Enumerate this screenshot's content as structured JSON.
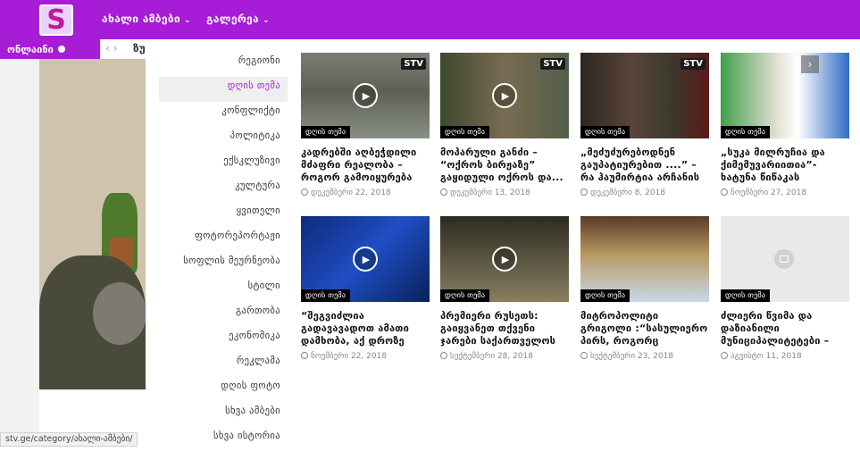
{
  "header": {
    "nav": [
      {
        "label": "ახალი ამბები"
      },
      {
        "label": "გალერეა"
      }
    ]
  },
  "ticker": {
    "online_label": "ონლაინი",
    "text": "ზუ"
  },
  "categories": [
    {
      "label": "რეგიონი"
    },
    {
      "label": "დღის თემა"
    },
    {
      "label": "კონფლიქტი"
    },
    {
      "label": "პოლიტიკა"
    },
    {
      "label": "ექსკლუზივი"
    },
    {
      "label": "კულტურა"
    },
    {
      "label": "ყვითელი"
    },
    {
      "label": "ფოტორეპორტაჟი"
    },
    {
      "label": "სოფლის მეურნეობა"
    },
    {
      "label": "სტილი"
    },
    {
      "label": "გართობა"
    },
    {
      "label": "ეკონომიკა"
    },
    {
      "label": "რეკლამა"
    },
    {
      "label": "დღის ფოტო"
    },
    {
      "label": "სხვა ამბები"
    },
    {
      "label": "სხვა ისტორია"
    }
  ],
  "active_category": "დღის თემა",
  "posts": [
    {
      "badge": "დღის თემა",
      "title": "კადრებში აღბეჭდილი მძაფრი რეალობა – როგორ გამოიყურება სახლი,...",
      "date": "დეკემბერი 22, 2018",
      "video": true
    },
    {
      "badge": "დღის თემა",
      "title": "მოპარული განძი – “ოქროს ბირჟაზე” გაყიდული ოქროს და...",
      "date": "დეკემბერი 13, 2018",
      "video": true
    },
    {
      "badge": "დღის თემა",
      "title": "„მეძუძურებოდნენ გაუპატიურებით ....” – რა ჰაუმირტია არჩანის წამებასთან...",
      "date": "დეკემბერი 8, 2018",
      "video": true
    },
    {
      "badge": "დღის თემა",
      "title": "„სუკა მილრუჩია და ქიმემუვარიითია”-ხატუნა წიწაკას ლიტერატურული ესე...",
      "date": "ნოემბერი 27, 2018",
      "video": false
    },
    {
      "badge": "დღის თემა",
      "title": "“შეგვიძლია გადავავადოთ ამათი დამხობა, აქ დროზე დავამხოთ...”-ახალი ფარული...",
      "date": "ნოემბერი 22, 2018",
      "video": true
    },
    {
      "badge": "დღის თემა",
      "title": "პრემიერი რუსეთს: გაიყვანეთ თქვენი ჯარები საქართველოს ტერიტორიიდან",
      "date": "სექტემბერი 28, 2018",
      "video": true
    },
    {
      "badge": "დღის თემა",
      "title": "მიტროპოლიტი გრიგოლი :“სასულიერო პირს, როგორც მოქალაქეს აქვს უფლებამოსილება,...",
      "date": "სექტემბერი 23, 2018",
      "video": false
    },
    {
      "badge": "დღის თემა",
      "title": "ძლიერი წვიმა და დაზიანილი მუნიციპალიტეტები – საგზაუროვლი სიტუაცი...",
      "date": "აგვისტო 11, 2018",
      "video": false
    }
  ],
  "thumb_labels": [
    "STV",
    "STV",
    "STV"
  ],
  "status_url": "stv.ge/category/ახალი-ამბები/",
  "colors": {
    "brand": "#a71cd6",
    "badge_bg": "#000000"
  },
  "icons": {
    "logo": "stv-logo",
    "play": "play-icon",
    "clock": "clock-icon",
    "image_placeholder": "image-icon",
    "next": "chevron-right-icon"
  }
}
